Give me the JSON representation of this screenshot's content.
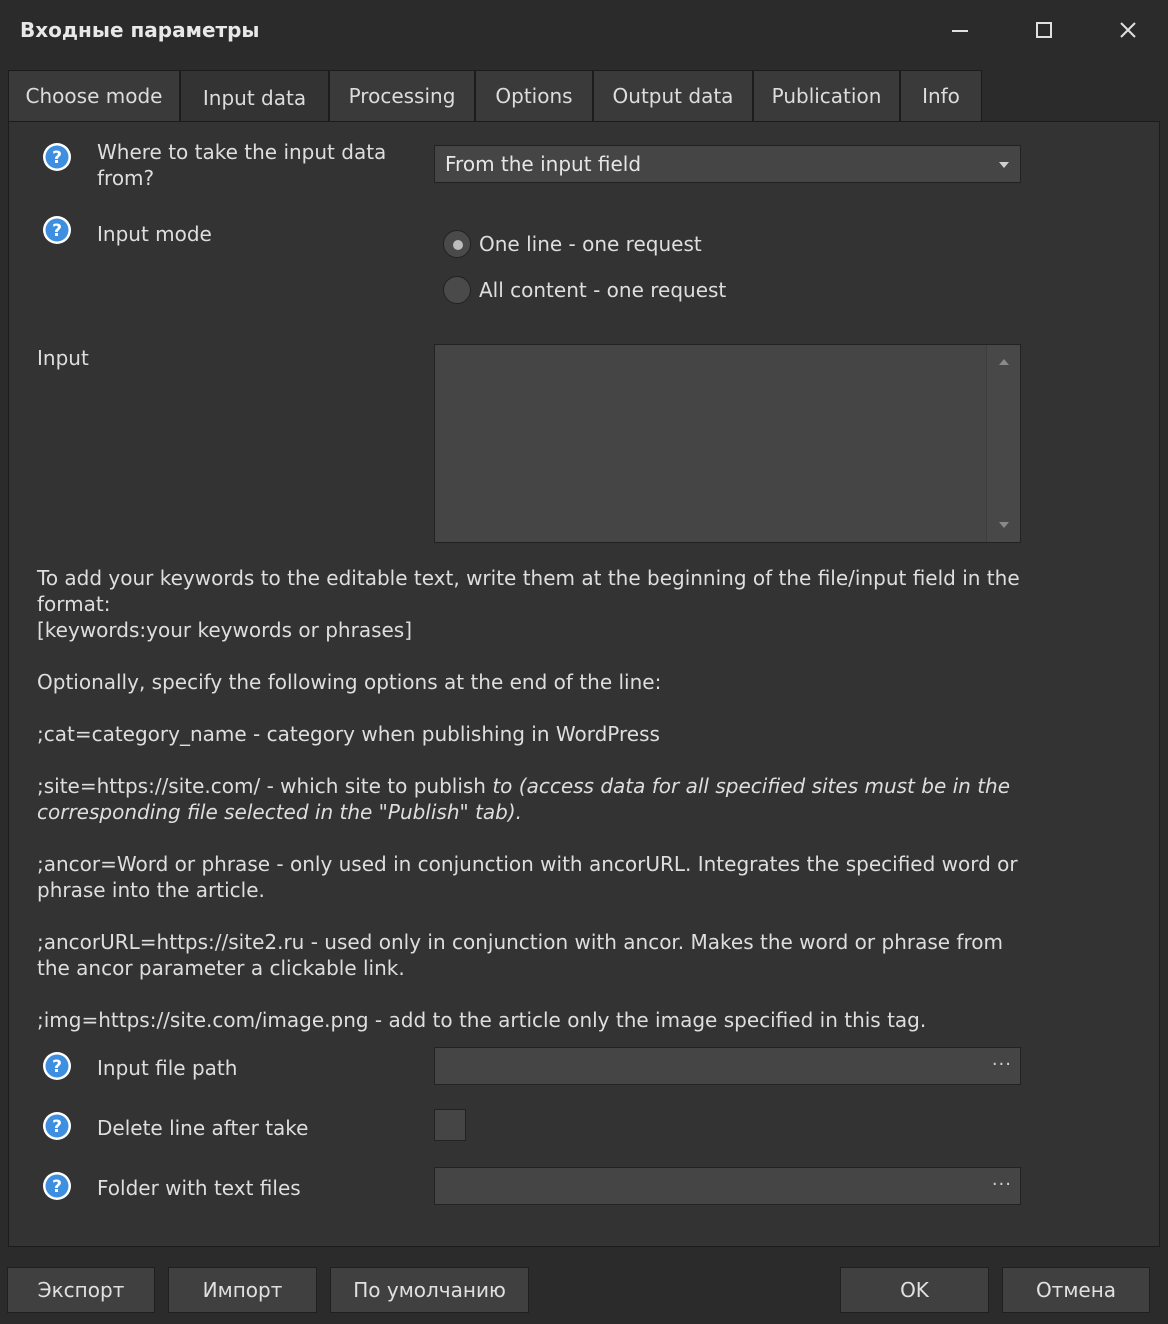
{
  "window": {
    "title": "Входные параметры"
  },
  "tabs": [
    {
      "label": "Choose mode"
    },
    {
      "label": "Input data",
      "active": true
    },
    {
      "label": "Processing"
    },
    {
      "label": "Options"
    },
    {
      "label": "Output data"
    },
    {
      "label": "Publication"
    },
    {
      "label": "Info"
    }
  ],
  "source": {
    "label": "Where to take the input data from?",
    "label_line1": "Where to take the input data",
    "label_line2": "from?",
    "selected": "From the input field"
  },
  "input_mode": {
    "label": "Input mode",
    "options": [
      {
        "label": "One line - one request",
        "checked": true
      },
      {
        "label": "All content - one request",
        "checked": false
      }
    ]
  },
  "input": {
    "label": "Input",
    "value": ""
  },
  "help": {
    "p1_line1": "To add your keywords to the editable text, write them at the beginning of the file/input field in the format:",
    "p1_line2": "[keywords:your keywords or phrases]",
    "p2": "Optionally, specify the following options at the end of the line:",
    "p3": ";cat=category_name - category when publishing in WordPress",
    "p4_normal": ";site=https://site.com/ - which site to publish ",
    "p4_italic": "to (access data for all specified sites must be in the corresponding file selected in the \"Publish\" tab).",
    "p5": ";ancor=Word or phrase - only used in conjunction with ancorURL. Integrates the specified word or phrase into the article.",
    "p6": ";ancorURL=https://site2.ru - used only in conjunction with ancor. Makes the word or phrase from the ancor parameter a clickable link.",
    "p7": ";img=https://site.com/image.png - add to the article only the image specified in this tag."
  },
  "input_file": {
    "label": "Input file path",
    "value": "",
    "browse": "···"
  },
  "delete_line": {
    "label": "Delete line after take",
    "checked": false
  },
  "folder": {
    "label": "Folder with text files",
    "value": "",
    "browse": "···"
  },
  "buttons": {
    "export": "Экспорт",
    "import": "Импорт",
    "defaults": "По умолчанию",
    "ok": "OK",
    "cancel": "Отмена"
  },
  "colors": {
    "background": "#2b2b2b",
    "panel": "#333333",
    "help_icon": "#3f8fe0"
  },
  "icons": {
    "help": "question-circle-icon",
    "minimize": "minimize-icon",
    "maximize": "maximize-icon",
    "close": "close-icon"
  }
}
